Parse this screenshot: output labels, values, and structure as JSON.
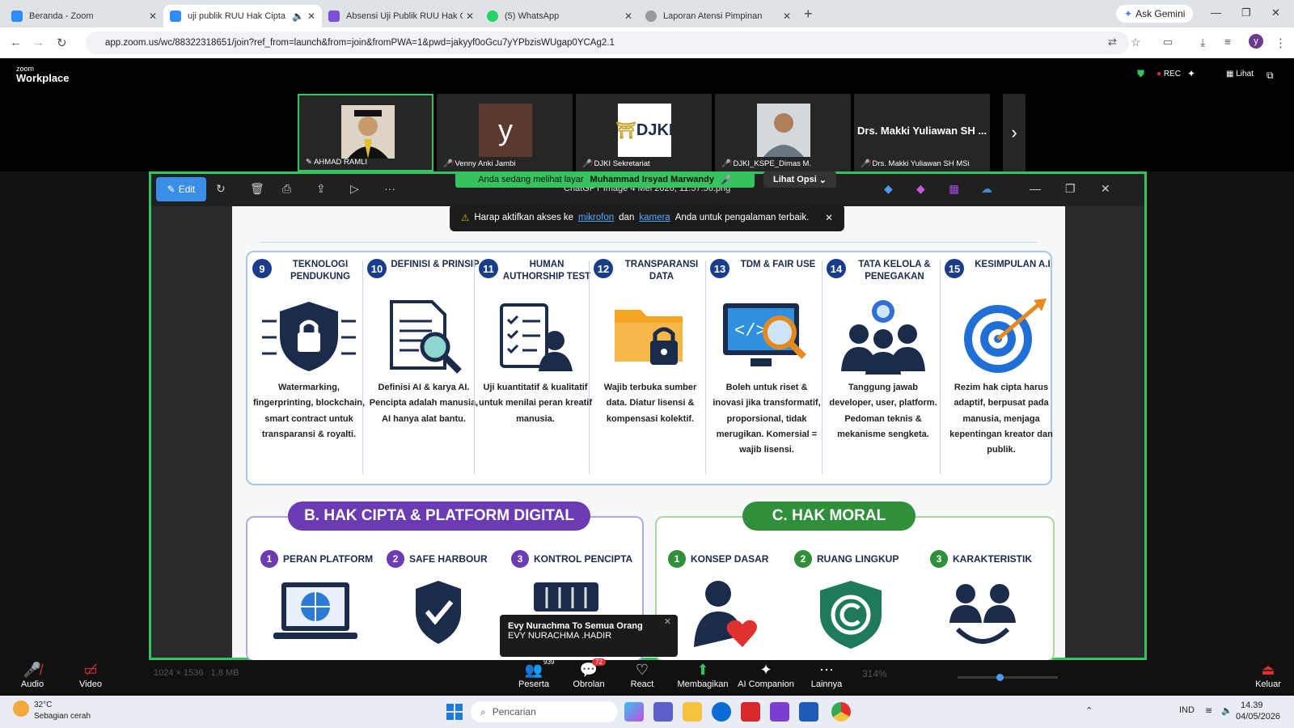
{
  "browser": {
    "tabs": [
      {
        "title": "Beranda - Zoom",
        "color": "#2d8cff"
      },
      {
        "title": "uji publik RUU Hak Cipta",
        "color": "#2d8cff"
      },
      {
        "title": "Absensi Uji Publik RUU Hak Cip",
        "color": "#7b4fd8"
      },
      {
        "title": "(5) WhatsApp",
        "color": "#25d366"
      },
      {
        "title": "Laporan Atensi Pimpinan",
        "color": "#777777"
      }
    ],
    "ask_gemini": "Ask Gemini",
    "url": "app.zoom.us/wc/88322318651/join?ref_from=launch&from=join&fromPWA=1&pwd=jakyyf0oGcu7yYPbzisWUgap0YCAg2.1"
  },
  "zoom_header": {
    "logo_small": "zoom",
    "logo_big": "Workplace",
    "rec": "REC",
    "view": "Lihat"
  },
  "participants": [
    {
      "name": "AHMAD RAMLI",
      "type": "photo"
    },
    {
      "name": "Venny Anki Jambi",
      "type": "letter",
      "letter": "y"
    },
    {
      "name": "DJKI Sekretariat",
      "type": "logo",
      "logo": "DJKI"
    },
    {
      "name": "DJKI_KSPE_Dimas M.",
      "type": "photo"
    },
    {
      "name": "Drs. Makki Yuliawan SH MSi",
      "type": "name",
      "big": "Drs. Makki Yuliawan SH ..."
    }
  ],
  "viewer": {
    "edit_label": "Edit",
    "file_name": "ChatGPT Image 4 Mei 2026, 11.57.56.png"
  },
  "share_bar": {
    "prefix": "Anda sedang melihat layar",
    "presenter": "Muhammad Irsyad Marwandy",
    "options": "Lihat Opsi"
  },
  "warning": {
    "pre": "Harap aktifkan akses ke",
    "mic": "mikrofon",
    "and": "dan",
    "cam": "kamera",
    "post": "Anda untuk pengalaman terbaik."
  },
  "infographic": {
    "row_a": [
      {
        "n": "9",
        "title": "TEKNOLOGI PENDUKUNG",
        "desc": "Watermarking, fingerprinting, blockchain, smart contract untuk transparansi & royalti.",
        "icon": "shield-lock-icon"
      },
      {
        "n": "10",
        "title": "DEFINISI & PRINSIP",
        "desc": "Definisi AI & karya AI. Pencipta adalah manusia, AI hanya alat bantu.",
        "icon": "document-search-icon"
      },
      {
        "n": "11",
        "title": "HUMAN AUTHORSHIP TEST",
        "desc": "Uji kuantitatif & kualitatif untuk menilai peran kreatif manusia.",
        "icon": "checklist-person-icon"
      },
      {
        "n": "12",
        "title": "TRANSPARANSI DATA",
        "desc": "Wajib terbuka sumber data. Diatur lisensi & kompensasi kolektif.",
        "icon": "folder-lock-icon"
      },
      {
        "n": "13",
        "title": "TDM & FAIR USE",
        "desc": "Boleh untuk riset & inovasi jika transformatif, proporsional, tidak merugikan. Komersial = wajib lisensi.",
        "icon": "monitor-search-icon"
      },
      {
        "n": "14",
        "title": "TATA KELOLA & PENEGAKAN",
        "desc": "Tanggung jawab developer, user, platform. Pedoman teknis & mekanisme sengketa.",
        "icon": "people-search-icon"
      },
      {
        "n": "15",
        "title": "KESIMPULAN A.I",
        "desc": "Rezim hak cipta harus adaptif, berpusat pada manusia, menjaga kepentingan kreator dan publik.",
        "icon": "target-icon"
      }
    ],
    "section_b": {
      "title": "B. HAK CIPTA & PLATFORM DIGITAL",
      "items": [
        {
          "n": "1",
          "title": "PERAN PLATFORM"
        },
        {
          "n": "2",
          "title": "SAFE HARBOUR"
        },
        {
          "n": "3",
          "title": "KONTROL PENCIPTA"
        }
      ]
    },
    "section_c": {
      "title": "C. HAK MORAL",
      "items": [
        {
          "n": "1",
          "title": "KONSEP DASAR"
        },
        {
          "n": "2",
          "title": "RUANG LINGKUP"
        },
        {
          "n": "3",
          "title": "KARAKTERISTIK"
        }
      ]
    }
  },
  "chat_popup": {
    "from": "Evy Nurachma To Semua Orang",
    "message": "EVY NURACHMA .HADIR"
  },
  "controls": {
    "audio": "Audio",
    "video": "Video",
    "participants": "Peserta",
    "participants_count": "939",
    "chat": "Obrolan",
    "chat_badge": "72",
    "react": "React",
    "share": "Membagikan",
    "companion": "AI Companion",
    "more": "Lainnya",
    "leave": "Keluar",
    "zoom_level": "314%",
    "image_size": "1024 × 1536",
    "file_size": "1,8 MB"
  },
  "taskbar": {
    "temp": "32°C",
    "weather": "Sebagian cerah",
    "search": "Pencarian",
    "lang": "IND",
    "time": "14.39",
    "date": "04/05/2026"
  }
}
